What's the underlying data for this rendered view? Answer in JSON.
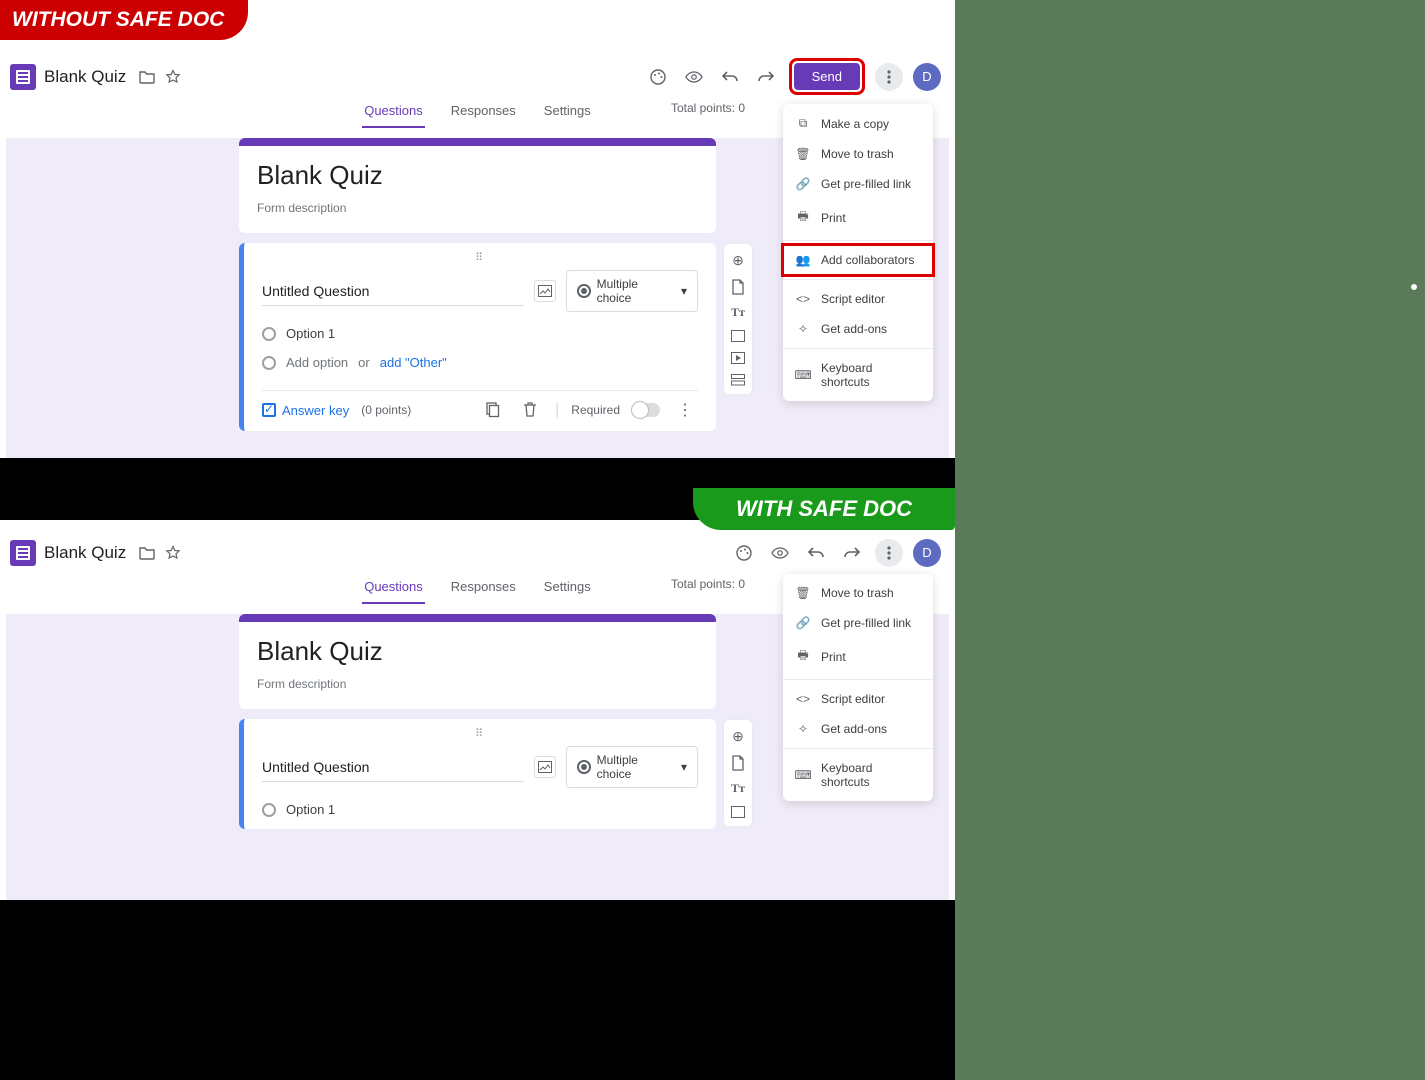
{
  "badges": {
    "without": "WITHOUT SAFE DOC",
    "with": "WITH SAFE DOC"
  },
  "header": {
    "docname": "Blank Quiz",
    "send": "Send",
    "avatar": "D"
  },
  "tabs": {
    "questions": "Questions",
    "responses": "Responses",
    "settings": "Settings",
    "points": "Total points: 0"
  },
  "form": {
    "title": "Blank Quiz",
    "desc": "Form description"
  },
  "question": {
    "title": "Untitled Question",
    "type": "Multiple choice",
    "option1": "Option 1",
    "addopt": "Add option",
    "or": "or",
    "addother": "add \"Other\"",
    "answerkey": "Answer key",
    "points": "(0 points)",
    "required": "Required"
  },
  "menu1": {
    "copy": "Make a copy",
    "trash": "Move to trash",
    "prefilled": "Get pre-filled link",
    "print": "Print",
    "collab": "Add collaborators",
    "script": "Script editor",
    "addons": "Get add-ons",
    "shortcuts": "Keyboard shortcuts"
  },
  "menu2": {
    "trash": "Move to trash",
    "prefilled": "Get pre-filled link",
    "print": "Print",
    "script": "Script editor",
    "addons": "Get add-ons",
    "shortcuts": "Keyboard shortcuts"
  }
}
